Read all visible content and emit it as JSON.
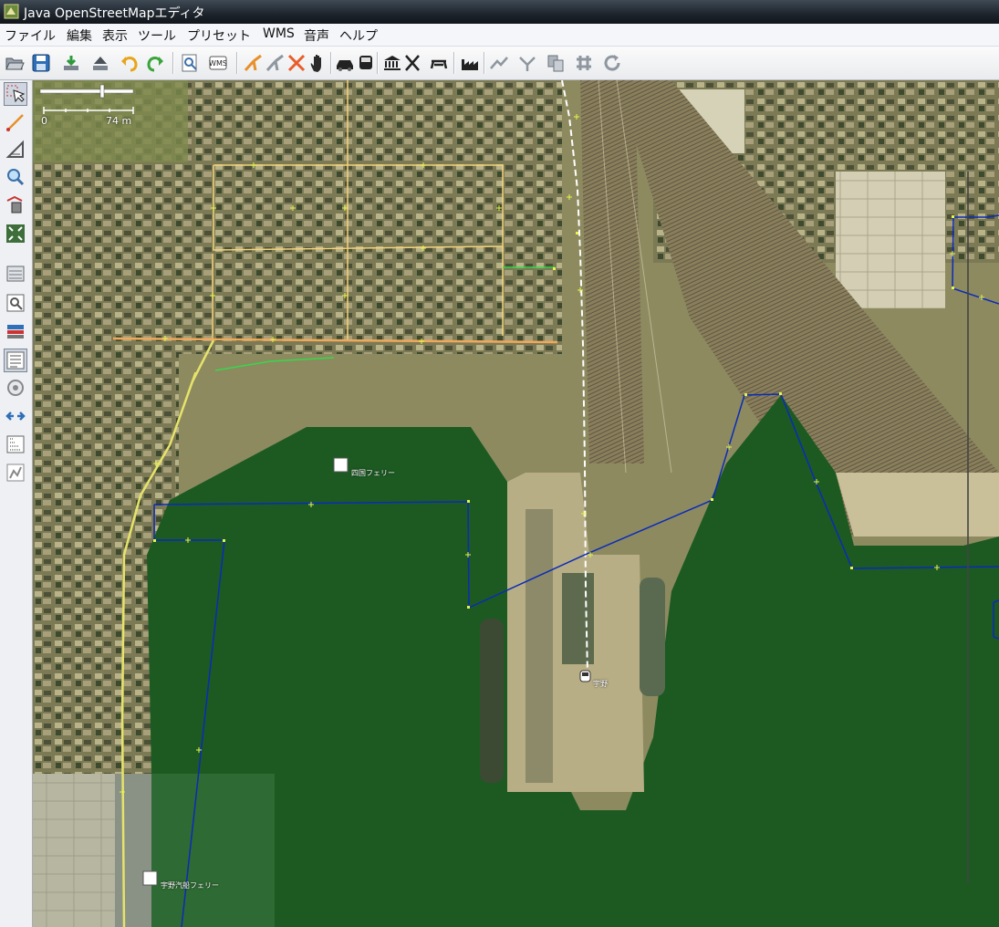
{
  "window": {
    "title": "Java OpenStreetMapエディタ",
    "icon": "josm-app-icon"
  },
  "menu": [
    {
      "id": "file",
      "label": "ファイル"
    },
    {
      "id": "edit",
      "label": "編集"
    },
    {
      "id": "view",
      "label": "表示"
    },
    {
      "id": "tools",
      "label": "ツール"
    },
    {
      "id": "presets",
      "label": "プリセット"
    },
    {
      "id": "wms",
      "label": "WMS"
    },
    {
      "id": "audio",
      "label": "音声"
    },
    {
      "id": "help",
      "label": "ヘルプ"
    }
  ],
  "toolbar": [
    "open-file-icon",
    "save-icon",
    "download-icon",
    "upload-icon",
    "undo-icon",
    "redo-icon",
    "preferences-icon",
    "wms-icon",
    "road-icon",
    "road-alt-icon",
    "crossing-icon",
    "hand-icon",
    "car-icon",
    "bus-icon",
    "museum-icon",
    "restaurant-icon",
    "picnic-icon",
    "industrial-icon",
    "split-way-icon",
    "combine-way-icon",
    "copy-icon",
    "align-icon",
    "refresh-icon"
  ],
  "sidebar": [
    "select-icon",
    "draw-way-icon",
    "delete-icon",
    "zoom-icon",
    "extrude-icon",
    "fit-view-icon",
    "layers-icon",
    "inspect-icon",
    "history-icon",
    "list-icon",
    "relation-icon",
    "conflict-icon",
    "filter-icon",
    "validator-icon"
  ],
  "map": {
    "scale": {
      "start": "0",
      "end": "74 m"
    },
    "pois": [
      {
        "id": "ferry-shikoku",
        "label": "四国フェリー"
      },
      {
        "id": "station-uno",
        "label": "宇野"
      },
      {
        "id": "ferry-uno",
        "label": "宇野汽船フェリー"
      }
    ],
    "colors": {
      "water": "#1c5a22",
      "coastline": "#0b2bb8",
      "road": "#e6e36b",
      "residential": "#f3d37a",
      "footway": "#ffffff",
      "highway": "#f0a95c",
      "path": "#37d84b"
    }
  }
}
